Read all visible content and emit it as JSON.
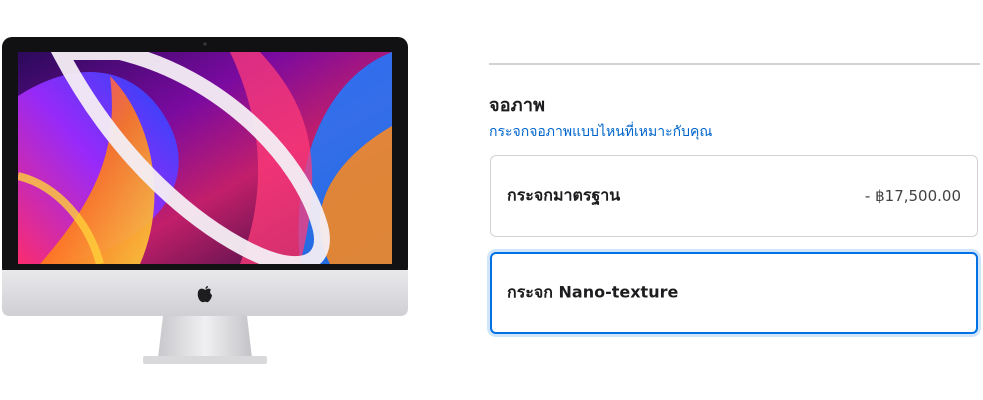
{
  "section": {
    "title": "จอภาพ",
    "help_link": "กระจกจอภาพแบบไหนที่เหมาะกับคุณ"
  },
  "options": [
    {
      "label": "กระจกมาตรฐาน",
      "price": "- ฿17,500.00",
      "selected": false
    },
    {
      "label": "กระจก Nano-texture",
      "price": "",
      "selected": true
    }
  ],
  "colors": {
    "link": "#0066cc",
    "selected_border": "#0071e3",
    "divider": "#d2d2d7"
  }
}
